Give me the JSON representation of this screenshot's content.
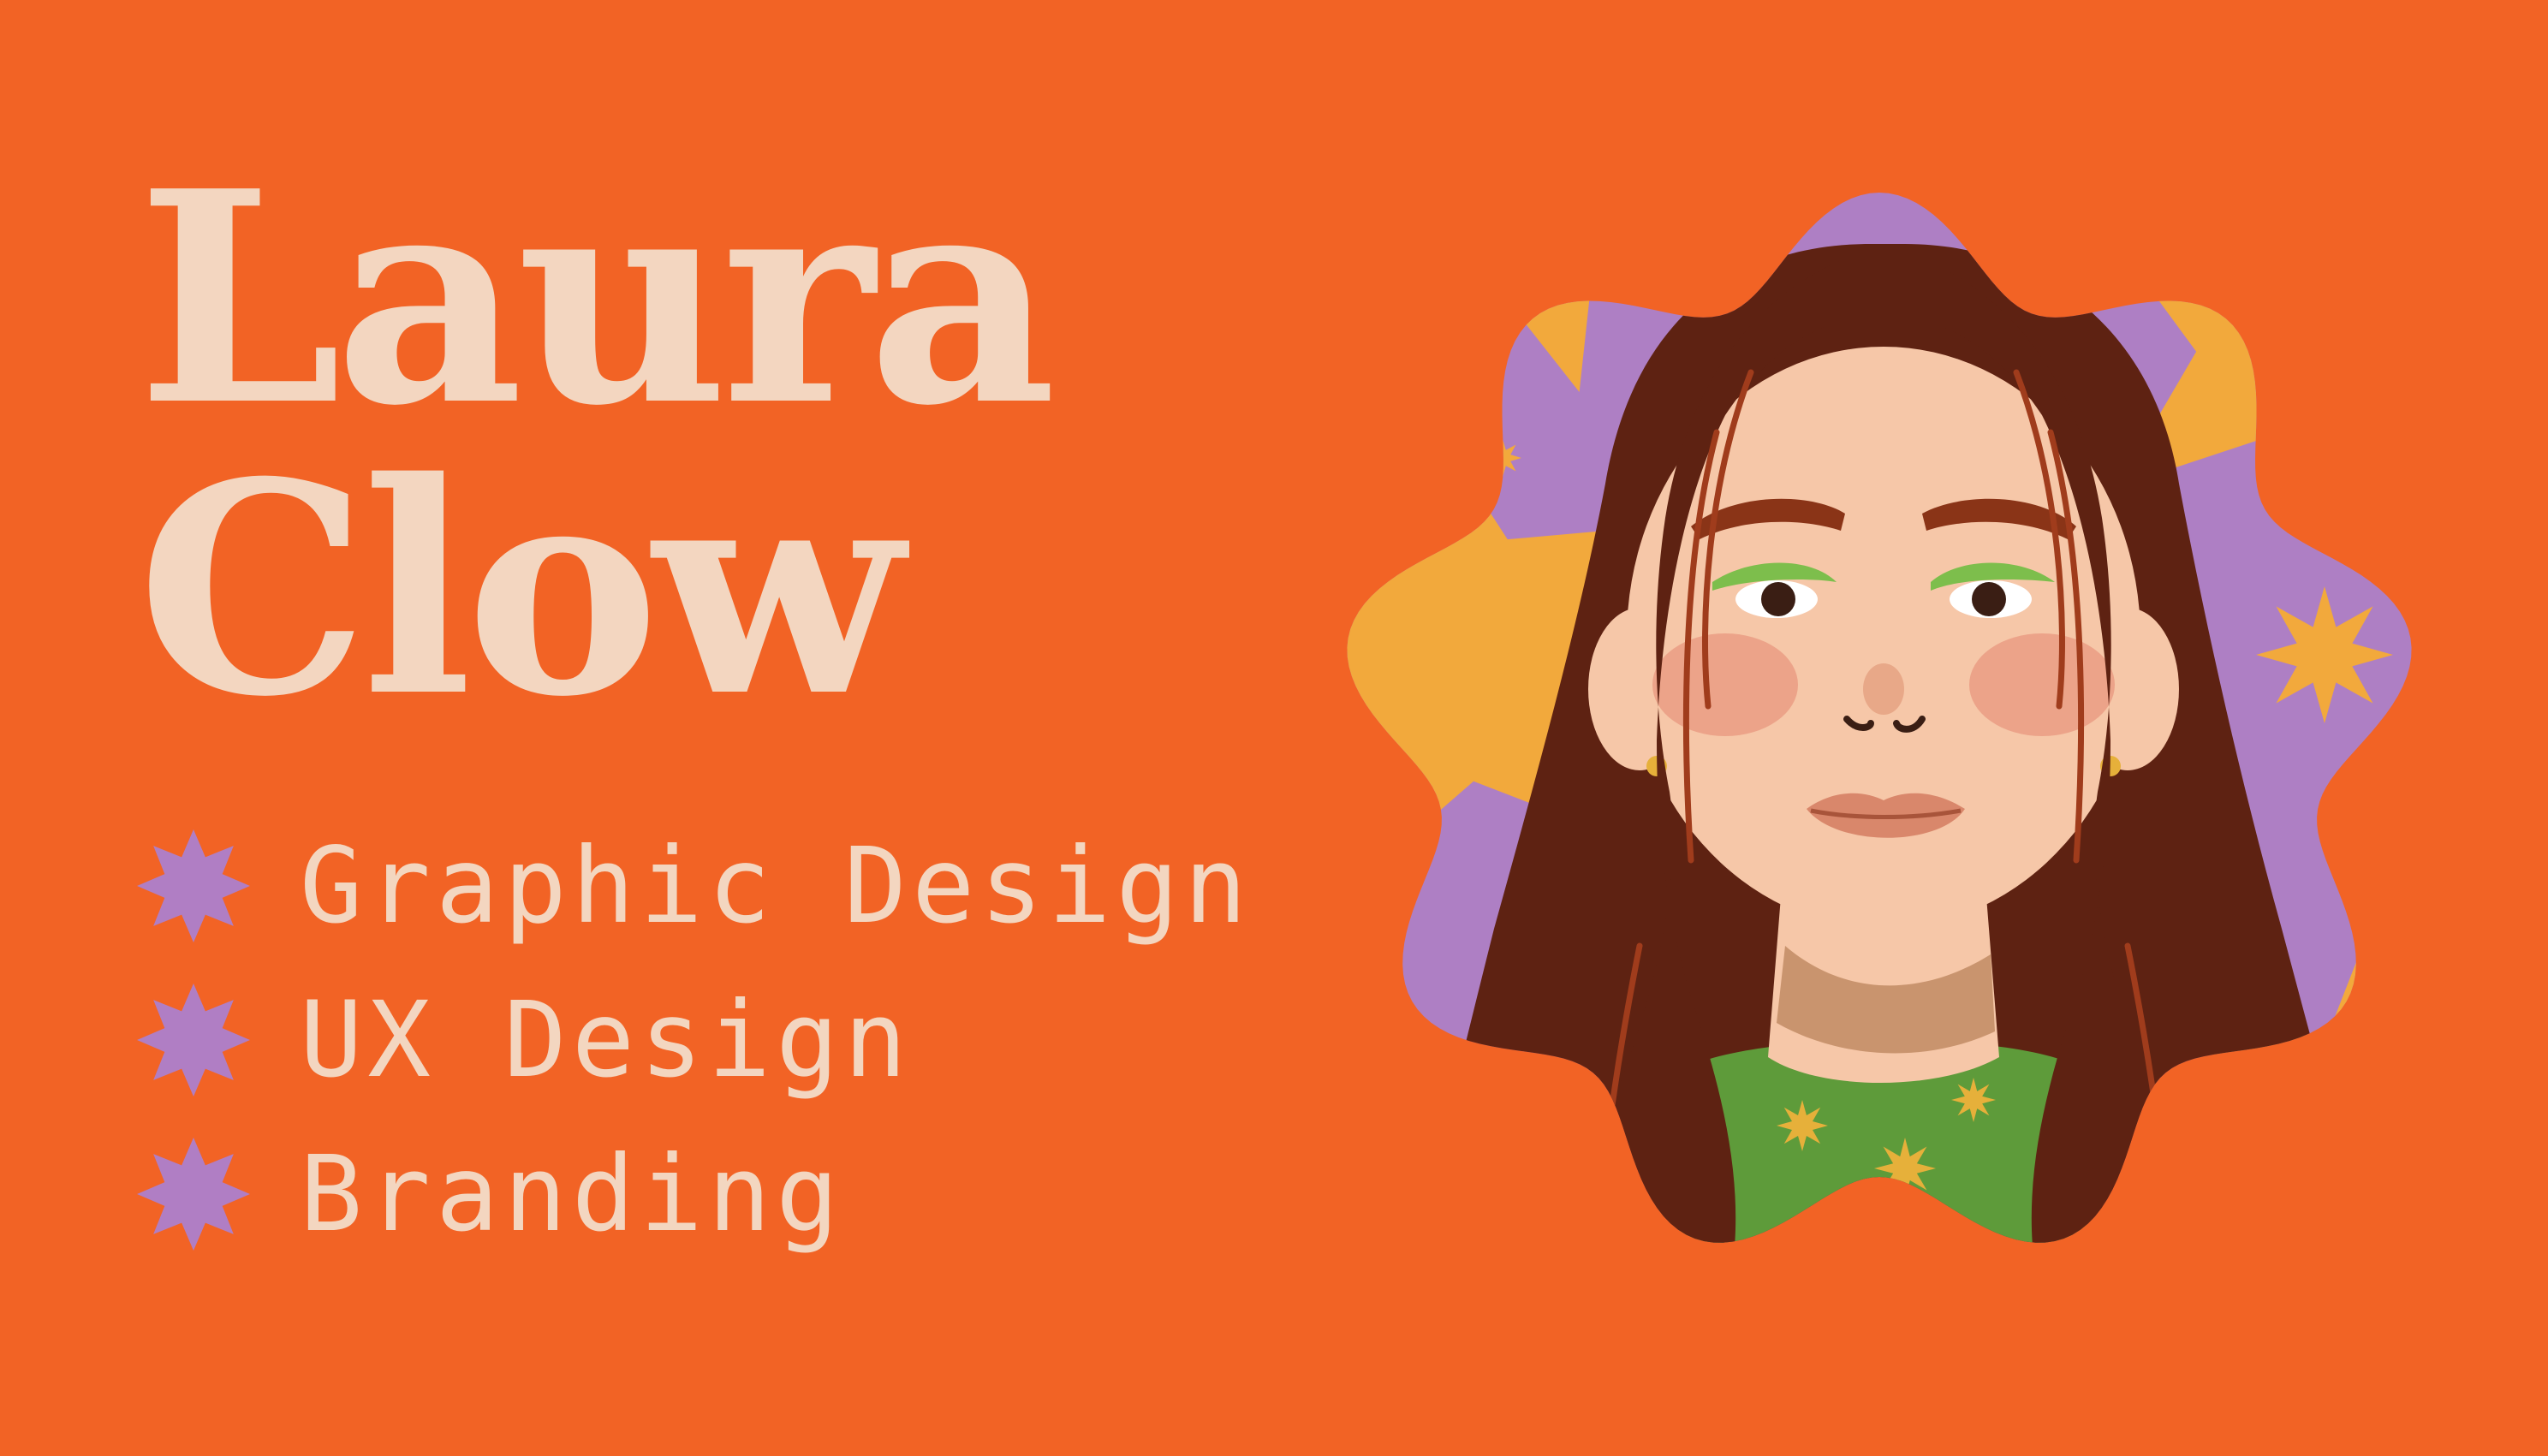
{
  "card": {
    "first_name": "Laura",
    "last_name": "Clow",
    "services": [
      {
        "label": "Graphic Design",
        "icon": "eight-point-star-icon"
      },
      {
        "label": "UX Design",
        "icon": "eight-point-star-icon"
      },
      {
        "label": "Branding",
        "icon": "eight-point-star-icon"
      }
    ]
  },
  "portrait": {
    "subject": "illustrated woman with long wavy brown hair",
    "shape": "scalloped-flower-frame"
  },
  "colors": {
    "background": "#F26325",
    "name_text": "#F3D6C0",
    "service_text": "#F3D6C0",
    "bullet_star": "#B07EC4",
    "portrait_purple": "#AE7FC4",
    "portrait_yellow": "#F2A93C",
    "hair": "#5E2212",
    "hair_highlight": "#A03C1C",
    "skin": "#F6C7A8",
    "blush": "#E8977F",
    "lips": "#D9876B",
    "shirt": "#5E9B3A",
    "shirt_star": "#E6B03A",
    "brow": "#8A3417",
    "eyeshadow": "#7DBE4C"
  }
}
